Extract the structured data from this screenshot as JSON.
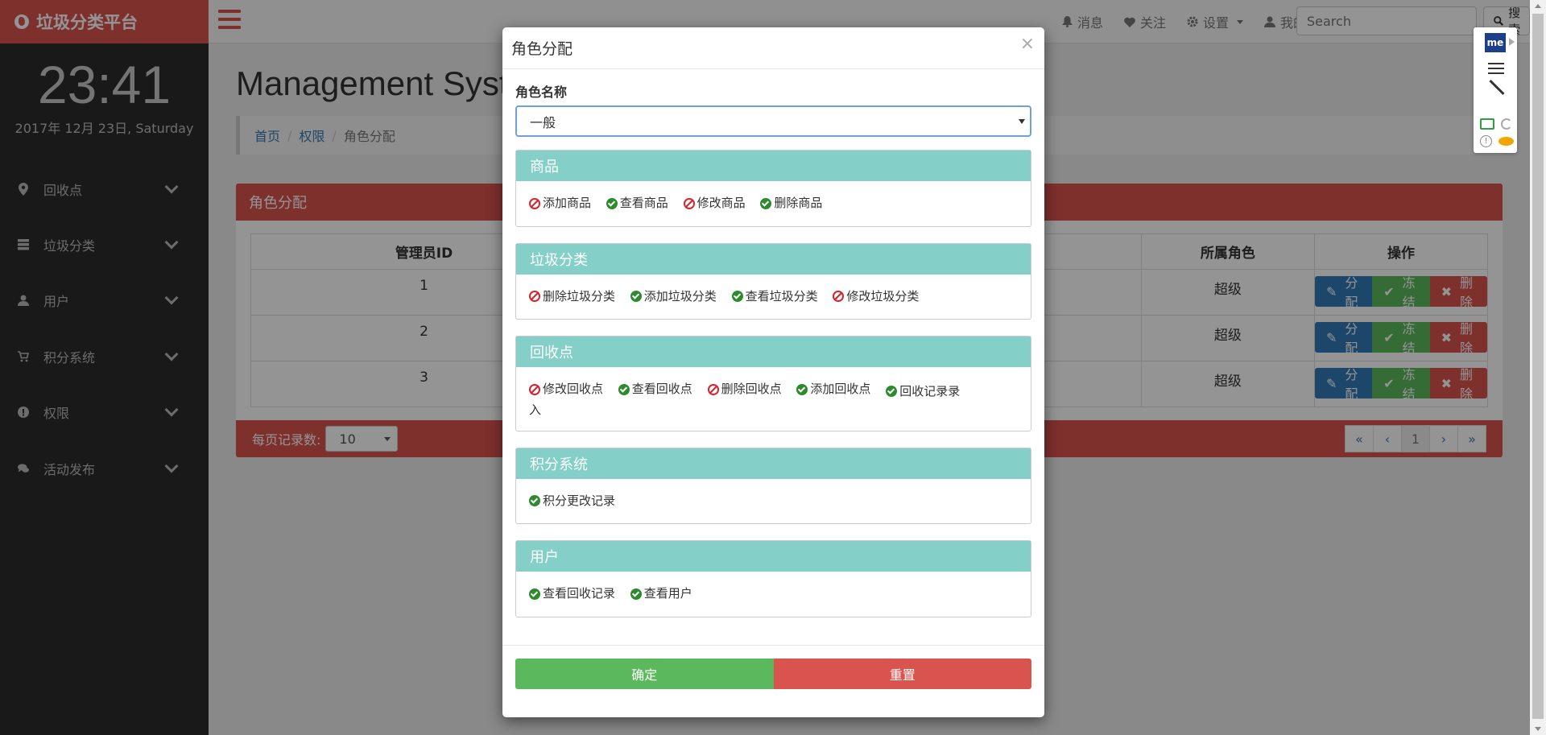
{
  "app": {
    "brand": "垃圾分类平台"
  },
  "clock": {
    "time": "23:41",
    "date": "2017年 12月 23日, Saturday"
  },
  "sidebar": {
    "items": [
      {
        "label": "回收点",
        "icon": "map-marker-icon"
      },
      {
        "label": "垃圾分类",
        "icon": "server-icon"
      },
      {
        "label": "用户",
        "icon": "user-icon"
      },
      {
        "label": "积分系统",
        "icon": "shopping-cart-icon"
      },
      {
        "label": "权限",
        "icon": "exclamation-icon"
      },
      {
        "label": "活动发布",
        "icon": "comments-icon"
      }
    ]
  },
  "topbar": {
    "messages": "消息",
    "follow": "关注",
    "settings": "设置",
    "mine": "我的",
    "search_placeholder": "Search",
    "search_button": "搜索"
  },
  "main": {
    "title": "Management System",
    "breadcrumb": [
      "首页",
      "权限",
      "角色分配"
    ],
    "panel_title": "角色分配",
    "table": {
      "headers": [
        "管理员ID",
        "所属角色",
        "操作"
      ],
      "rows": [
        {
          "id": "1",
          "role": "超级"
        },
        {
          "id": "2",
          "role": "超级"
        },
        {
          "id": "3",
          "role": "超级"
        }
      ],
      "actions": {
        "assign": "分配",
        "freeze": "冻结",
        "delete": "删除"
      }
    },
    "footer": {
      "per_page_label": "每页记录数:",
      "per_page_value": "10",
      "pager": [
        "«",
        "‹",
        "1",
        "›",
        "»"
      ]
    }
  },
  "modal": {
    "title": "角色分配",
    "close": "×",
    "role_label": "角色名称",
    "role_value": "一般",
    "groups": [
      {
        "name": "商品",
        "perms": [
          {
            "label": "添加商品",
            "granted": false
          },
          {
            "label": "查看商品",
            "granted": true
          },
          {
            "label": "修改商品",
            "granted": false
          },
          {
            "label": "删除商品",
            "granted": true
          }
        ]
      },
      {
        "name": "垃圾分类",
        "perms": [
          {
            "label": "删除垃圾分类",
            "granted": false
          },
          {
            "label": "添加垃圾分类",
            "granted": true
          },
          {
            "label": "查看垃圾分类",
            "granted": true
          },
          {
            "label": "修改垃圾分类",
            "granted": false
          }
        ]
      },
      {
        "name": "回收点",
        "perms": [
          {
            "label": "修改回收点",
            "granted": false
          },
          {
            "label": "查看回收点",
            "granted": true
          },
          {
            "label": "删除回收点",
            "granted": false
          },
          {
            "label": "添加回收点",
            "granted": true
          },
          {
            "label": "回收记录录入",
            "granted": true
          }
        ]
      },
      {
        "name": "积分系统",
        "perms": [
          {
            "label": "积分更改记录",
            "granted": true
          }
        ]
      },
      {
        "name": "用户",
        "perms": [
          {
            "label": "查看回收记录",
            "granted": true
          },
          {
            "label": "查看用户",
            "granted": true
          }
        ]
      }
    ],
    "confirm": "确定",
    "reset": "重置"
  },
  "extension": {
    "badge": "me"
  },
  "colors": {
    "brand": "#d9534f",
    "accent_teal": "#84d0c8",
    "ok": "#5cb85c",
    "primary": "#337ab7",
    "sidebar": "#2b2b2b"
  }
}
